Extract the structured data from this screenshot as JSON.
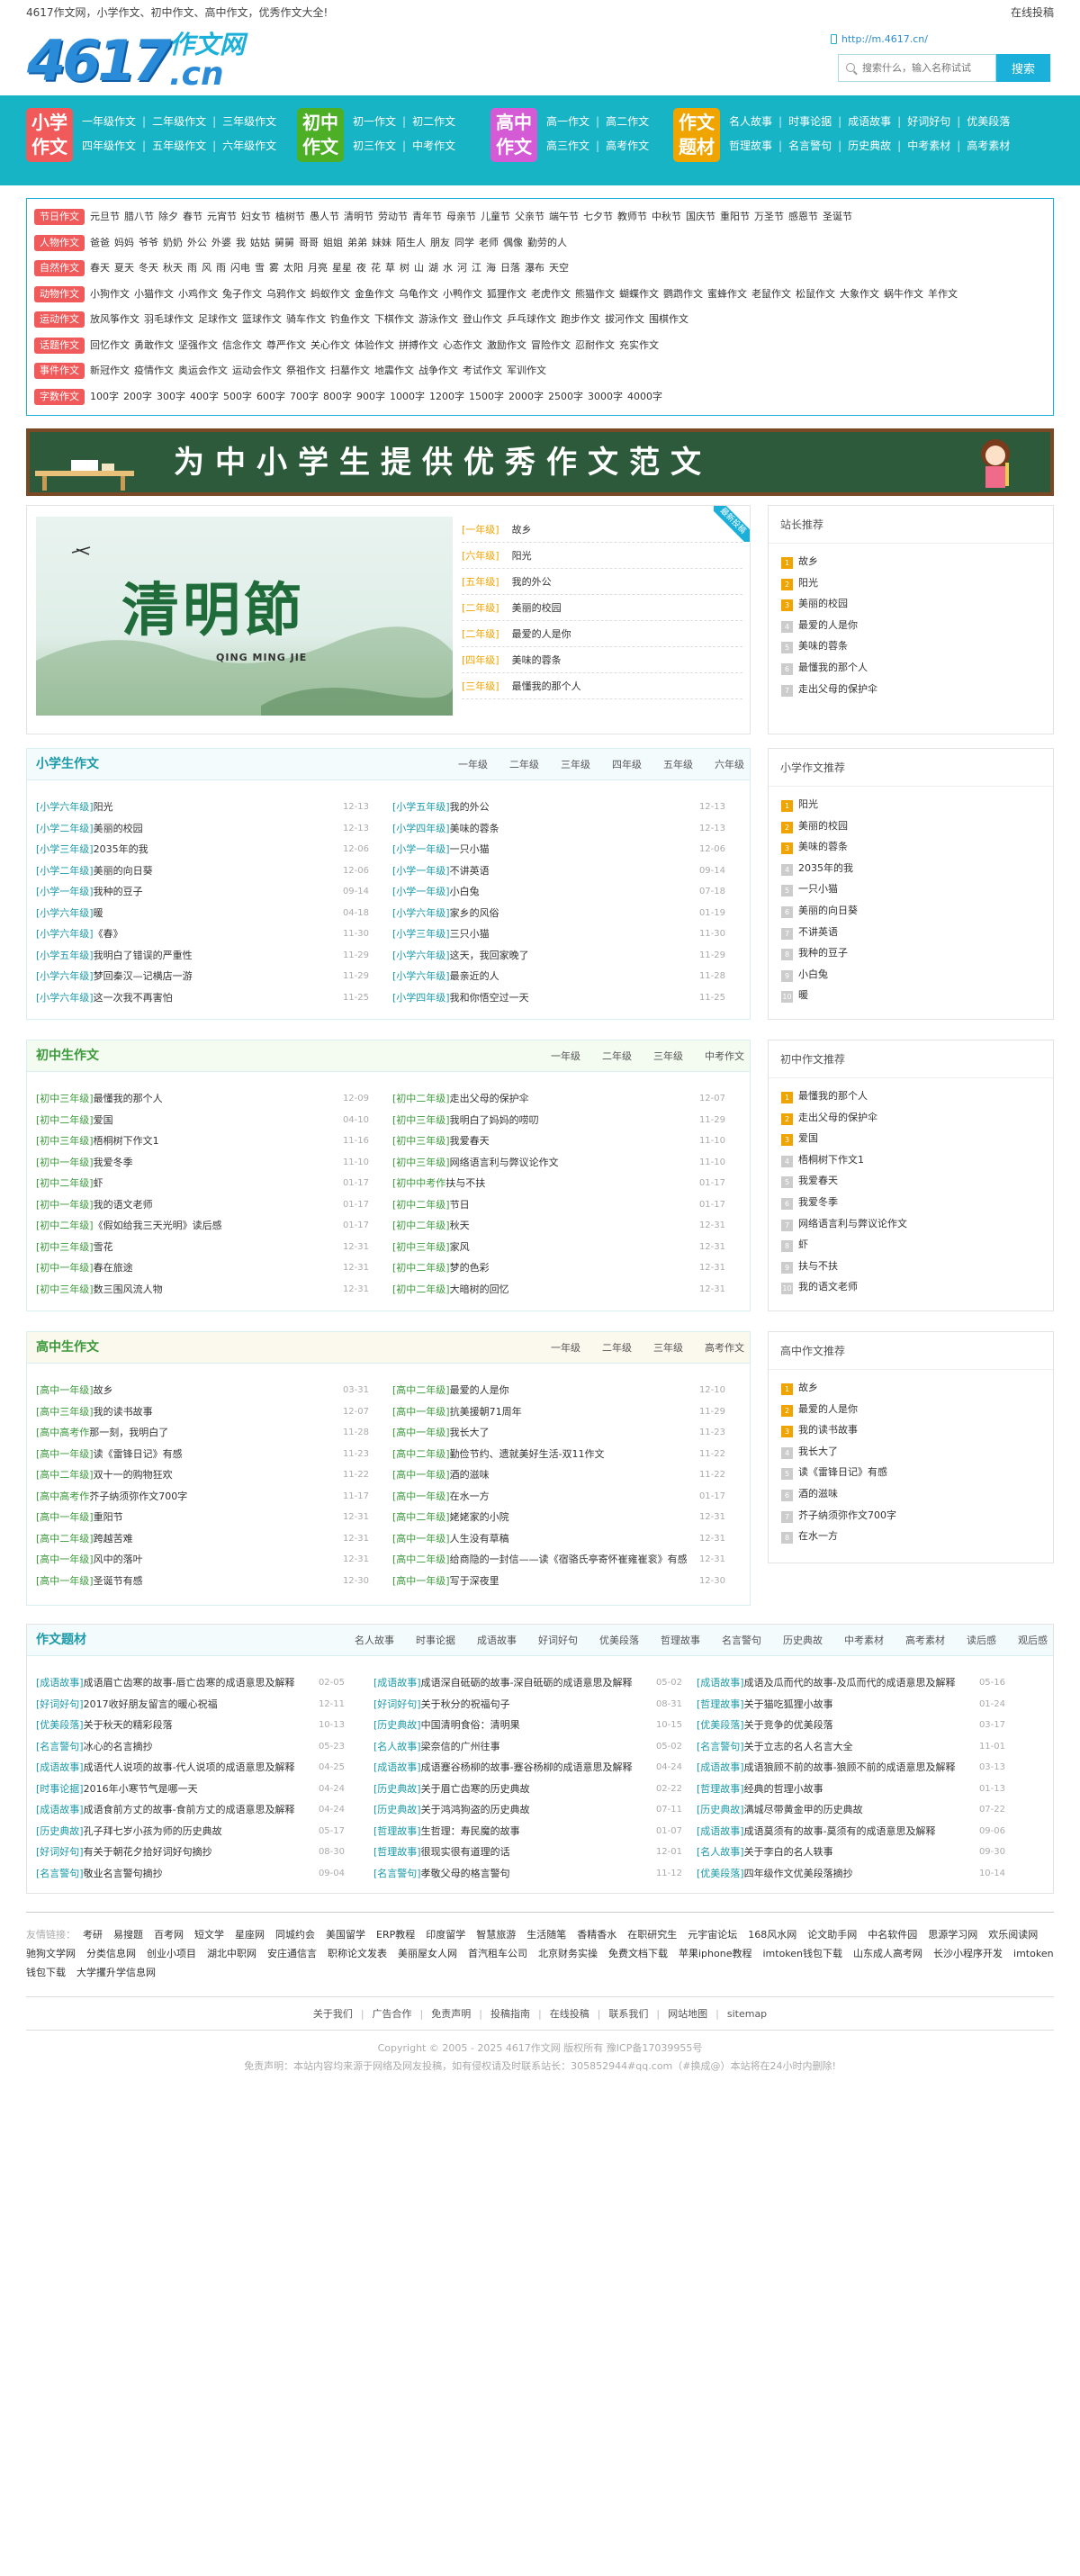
{
  "topbar": {
    "slogan": "4617作文网，小学作文、初中作文、高中作文，优秀作文大全!",
    "right": "在线投稿"
  },
  "header": {
    "logo_num": "4617",
    "logo_zw": "作文网",
    "logo_cn": ".cn",
    "url": "http://m.4617.cn/",
    "search_placeholder": "搜索什么，输入名称试试",
    "search_button": "搜索"
  },
  "nav": [
    {
      "big": [
        "小学",
        "作文"
      ],
      "color": "#f05a5a",
      "rows": [
        [
          "一年级作文",
          "二年级作文",
          "三年级作文"
        ],
        [
          "四年级作文",
          "五年级作文",
          "六年级作文"
        ]
      ]
    },
    {
      "big": [
        "初中",
        "作文"
      ],
      "color": "#4caf26",
      "rows": [
        [
          "初一作文",
          "初二作文"
        ],
        [
          "初三作文",
          "中考作文"
        ]
      ]
    },
    {
      "big": [
        "高中",
        "作文"
      ],
      "color": "#d45bd5",
      "rows": [
        [
          "高一作文",
          "高二作文"
        ],
        [
          "高三作文",
          "高考作文"
        ]
      ]
    },
    {
      "big": [
        "作文",
        "题材"
      ],
      "color": "#f0a400",
      "rows": [
        [
          "名人故事",
          "时事论据",
          "成语故事",
          "好词好句",
          "优美段落"
        ],
        [
          "哲理故事",
          "名言警句",
          "历史典故",
          "中考素材",
          "高考素材"
        ]
      ]
    }
  ],
  "tags": [
    {
      "label": "节日作文",
      "items": [
        "元旦节",
        "腊八节",
        "除夕",
        "春节",
        "元宵节",
        "妇女节",
        "植树节",
        "愚人节",
        "清明节",
        "劳动节",
        "青年节",
        "母亲节",
        "儿童节",
        "父亲节",
        "端午节",
        "七夕节",
        "教师节",
        "中秋节",
        "国庆节",
        "重阳节",
        "万圣节",
        "感恩节",
        "圣诞节"
      ]
    },
    {
      "label": "人物作文",
      "items": [
        "爸爸",
        "妈妈",
        "爷爷",
        "奶奶",
        "外公",
        "外婆",
        "我",
        "姑姑",
        "舅舅",
        "哥哥",
        "姐姐",
        "弟弟",
        "妹妹",
        "陌生人",
        "朋友",
        "同学",
        "老师",
        "偶像",
        "勤劳的人"
      ]
    },
    {
      "label": "自然作文",
      "items": [
        "春天",
        "夏天",
        "冬天",
        "秋天",
        "雨",
        "风",
        "雨",
        "闪电",
        "雪",
        "雾",
        "太阳",
        "月亮",
        "星星",
        "夜",
        "花",
        "草",
        "树",
        "山",
        "湖",
        "水",
        "河",
        "江",
        "海",
        "日落",
        "瀑布",
        "天空"
      ]
    },
    {
      "label": "动物作文",
      "items": [
        "小狗作文",
        "小猫作文",
        "小鸡作文",
        "兔子作文",
        "乌鸦作文",
        "蚂蚁作文",
        "金鱼作文",
        "乌龟作文",
        "小鸭作文",
        "狐狸作文",
        "老虎作文",
        "熊猫作文",
        "蝴蝶作文",
        "鹦鹉作文",
        "蜜蜂作文",
        "老鼠作文",
        "松鼠作文",
        "大象作文",
        "蜗牛作文",
        "羊作文"
      ]
    },
    {
      "label": "运动作文",
      "items": [
        "放风筝作文",
        "羽毛球作文",
        "足球作文",
        "篮球作文",
        "骑车作文",
        "钓鱼作文",
        "下棋作文",
        "游泳作文",
        "登山作文",
        "乒乓球作文",
        "跑步作文",
        "拔河作文",
        "围棋作文"
      ]
    },
    {
      "label": "话题作文",
      "items": [
        "回忆作文",
        "勇敢作文",
        "坚强作文",
        "信念作文",
        "尊严作文",
        "关心作文",
        "体验作文",
        "拼搏作文",
        "心态作文",
        "激励作文",
        "冒险作文",
        "忍耐作文",
        "充实作文"
      ]
    },
    {
      "label": "事件作文",
      "items": [
        "新冠作文",
        "疫情作文",
        "奥运会作文",
        "运动会作文",
        "祭祖作文",
        "扫墓作文",
        "地震作文",
        "战争作文",
        "考试作文",
        "军训作文"
      ]
    },
    {
      "label": "字数作文",
      "items": [
        "100字",
        "200字",
        "300字",
        "400字",
        "500字",
        "600字",
        "700字",
        "800字",
        "900字",
        "1000字",
        "1200字",
        "1500字",
        "2000字",
        "2500字",
        "3000字",
        "4000字"
      ]
    }
  ],
  "banner": {
    "text": "为中小学生提供优秀作文范文"
  },
  "slide": {
    "cal": "清明節",
    "en": "QING MING JIE",
    "ribbon": "最新投稿",
    "list": [
      {
        "g": "[一年级]",
        "t": "故乡"
      },
      {
        "g": "[六年级]",
        "t": "阳光"
      },
      {
        "g": "[五年级]",
        "t": "我的外公"
      },
      {
        "g": "[二年级]",
        "t": "美丽的校园"
      },
      {
        "g": "[二年级]",
        "t": "最爱的人是你"
      },
      {
        "g": "[四年级]",
        "t": "美味的蓉条"
      },
      {
        "g": "[三年级]",
        "t": "最懂我的那个人"
      }
    ]
  },
  "side1": {
    "title": "站长推荐",
    "items": [
      "故乡",
      "阳光",
      "美丽的校园",
      "最爱的人是你",
      "美味的蓉条",
      "最懂我的那个人",
      "走出父母的保护伞"
    ]
  },
  "p1": {
    "title": "小学生作文",
    "tabs": [
      "一年级",
      "二年级",
      "三年级",
      "四年级",
      "五年级",
      "六年级"
    ],
    "left": [
      [
        "[小学六年级]",
        "阳光",
        "12-13"
      ],
      [
        "[小学二年级]",
        "美丽的校园",
        "12-13"
      ],
      [
        "[小学三年级]",
        "2035年的我",
        "12-06"
      ],
      [
        "[小学二年级]",
        "美丽的向日葵",
        "12-06"
      ],
      [
        "[小学一年级]",
        "我种的豆子",
        "09-14"
      ],
      [
        "[小学六年级]",
        "暖",
        "04-18"
      ],
      [
        "[小学六年级]",
        "《春》",
        "11-30"
      ],
      [
        "[小学五年级]",
        "我明白了错误的严重性",
        "11-29"
      ],
      [
        "[小学六年级]",
        "梦回秦汉—记横店一游",
        "11-29"
      ],
      [
        "[小学六年级]",
        "这一次我不再害怕",
        "11-25"
      ]
    ],
    "right": [
      [
        "[小学五年级]",
        "我的外公",
        "12-13"
      ],
      [
        "[小学四年级]",
        "美味的蓉条",
        "12-13"
      ],
      [
        "[小学一年级]",
        "一只小猫",
        "12-06"
      ],
      [
        "[小学一年级]",
        "不讲英语",
        "09-14"
      ],
      [
        "[小学一年级]",
        "小白兔",
        "07-18"
      ],
      [
        "[小学六年级]",
        "家乡的风俗",
        "01-19"
      ],
      [
        "[小学三年级]",
        "三只小猫",
        "11-30"
      ],
      [
        "[小学六年级]",
        "这天，我回家晚了",
        "11-29"
      ],
      [
        "[小学六年级]",
        "最亲近的人",
        "11-28"
      ],
      [
        "[小学四年级]",
        "我和你悟空过一天",
        "11-25"
      ]
    ]
  },
  "side2": {
    "title": "小学作文推荐",
    "items": [
      "阳光",
      "美丽的校园",
      "美味的蓉条",
      "2035年的我",
      "一只小猫",
      "美丽的向日葵",
      "不讲英语",
      "我种的豆子",
      "小白兔",
      "暖"
    ]
  },
  "p2": {
    "title": "初中生作文",
    "tabs": [
      "一年级",
      "二年级",
      "三年级",
      "中考作文"
    ],
    "left": [
      [
        "[初中三年级]",
        "最懂我的那个人",
        "12-09"
      ],
      [
        "[初中二年级]",
        "爱国",
        "04-10"
      ],
      [
        "[初中三年级]",
        "梧桐树下作文1",
        "11-16"
      ],
      [
        "[初中一年级]",
        "我爱冬季",
        "11-10"
      ],
      [
        "[初中二年级]",
        "虾",
        "01-17"
      ],
      [
        "[初中一年级]",
        "我的语文老师",
        "01-17"
      ],
      [
        "[初中二年级]",
        "《假如给我三天光明》读后感",
        "01-17"
      ],
      [
        "[初中三年级]",
        "雪花",
        "12-31"
      ],
      [
        "[初中一年级]",
        "春在旅途",
        "12-31"
      ],
      [
        "[初中三年级]",
        "数三围风流人物",
        "12-31"
      ]
    ],
    "right": [
      [
        "[初中二年级]",
        "走出父母的保护伞",
        "12-07"
      ],
      [
        "[初中三年级]",
        "我明白了妈妈的唠叨",
        "11-29"
      ],
      [
        "[初中三年级]",
        "我爱春天",
        "11-10"
      ],
      [
        "[初中三年级]",
        "网络语言利与弊议论作文",
        "11-10"
      ],
      [
        "[初中中考作",
        "扶与不扶",
        "01-17"
      ],
      [
        "[初中二年级]",
        "节日",
        "01-17"
      ],
      [
        "[初中二年级]",
        "秋天",
        "12-31"
      ],
      [
        "[初中三年级]",
        "家风",
        "12-31"
      ],
      [
        "[初中二年级]",
        "梦的色彩",
        "12-31"
      ],
      [
        "[初中二年级]",
        "大暗树的回忆",
        "12-31"
      ]
    ]
  },
  "side3": {
    "title": "初中作文推荐",
    "items": [
      "最懂我的那个人",
      "走出父母的保护伞",
      "爱国",
      "梧桐树下作文1",
      "我爱春天",
      "我爱冬季",
      "网络语言利与弊议论作文",
      "虾",
      "扶与不扶",
      "我的语文老师"
    ]
  },
  "p3": {
    "title": "高中生作文",
    "tabs": [
      "一年级",
      "二年级",
      "三年级",
      "高考作文"
    ],
    "left": [
      [
        "[高中一年级]",
        "故乡",
        "03-31"
      ],
      [
        "[高中三年级]",
        "我的读书故事",
        "12-07"
      ],
      [
        "[高中高考作",
        "那一刻，我明白了",
        "11-28"
      ],
      [
        "[高中一年级]",
        "读《雷锋日记》有感",
        "11-23"
      ],
      [
        "[高中二年级]",
        "双十一的购物狂欢",
        "11-22"
      ],
      [
        "[高中高考作",
        "芥子纳须弥作文700字",
        "11-17"
      ],
      [
        "[高中一年级]",
        "重阳节",
        "12-31"
      ],
      [
        "[高中二年级]",
        "跨越苦难",
        "12-31"
      ],
      [
        "[高中一年级]",
        "风中的落叶",
        "12-31"
      ],
      [
        "[高中一年级]",
        "圣诞节有感",
        "12-30"
      ]
    ],
    "right": [
      [
        "[高中二年级]",
        "最爱的人是你",
        "12-10"
      ],
      [
        "[高中一年级]",
        "抗美援朝71周年",
        "11-29"
      ],
      [
        "[高中一年级]",
        "我长大了",
        "11-23"
      ],
      [
        "[高中二年级]",
        "勤俭节约、遗就美好生活-双11作文",
        "11-22"
      ],
      [
        "[高中一年级]",
        "酒的滋味",
        "11-22"
      ],
      [
        "[高中一年级]",
        "在水一方",
        "01-17"
      ],
      [
        "[高中二年级]",
        "姥姥家的小院",
        "12-31"
      ],
      [
        "[高中一年级]",
        "人生没有草稿",
        "12-31"
      ],
      [
        "[高中二年级]",
        "给商隐的一封信——读《宿骆氏亭寄怀崔雍崔衮》有感",
        "12-31"
      ],
      [
        "[高中一年级]",
        "写于深夜里",
        "12-30"
      ]
    ]
  },
  "side4": {
    "title": "高中作文推荐",
    "items": [
      "故乡",
      "最爱的人是你",
      "我的读书故事",
      "我长大了",
      "读《雷锋日记》有感",
      "酒的滋味",
      "芥子纳须弥作文700字",
      "在水一方"
    ]
  },
  "p4": {
    "title": "作文题材",
    "tabs": [
      "名人故事",
      "时事论据",
      "成语故事",
      "好词好句",
      "优美段落",
      "哲理故事",
      "名言警句",
      "历史典故",
      "中考素材",
      "高考素材",
      "读后感",
      "观后感"
    ],
    "c1": [
      [
        "[成语故事]",
        "成语眉亡齿寒的故事-唇亡齿寒的成语意思及解释",
        "02-05"
      ],
      [
        "[好词好句]",
        "2017收好朋友留言的暖心祝福",
        "12-11"
      ],
      [
        "[优美段落]",
        "关于秋天的精彩段落",
        "10-13"
      ],
      [
        "[名言警句]",
        "冰心的名言摘抄",
        "05-23"
      ],
      [
        "[成语故事]",
        "成语代人说项的故事-代人说项的成语意思及解释",
        "04-25"
      ],
      [
        "[时事论据]",
        "2016年小寒节气是哪一天",
        "04-24"
      ],
      [
        "[成语故事]",
        "成语食前方丈的故事-食前方丈的成语意思及解释",
        "04-24"
      ],
      [
        "[历史典故]",
        "孔子拜七岁小孩为师的历史典故",
        "05-17"
      ],
      [
        "[好词好句]",
        "有关于朝花夕拾好词好句摘抄",
        "08-30"
      ],
      [
        "[名言警句]",
        "敬业名言警句摘抄",
        "09-04"
      ]
    ],
    "c2": [
      [
        "[成语故事]",
        "成语深自砥砺的故事-深自砥砺的成语意思及解释",
        "05-02"
      ],
      [
        "[好词好句]",
        "关于秋分的祝福句子",
        "08-31"
      ],
      [
        "[历史典故]",
        "中国清明食俗：清明果",
        "10-15"
      ],
      [
        "[名人故事]",
        "梁奈信的广州往事",
        "05-02"
      ],
      [
        "[成语故事]",
        "成语蹇谷杨柳的故事-蹇谷杨柳的成语意思及解释",
        "04-24"
      ],
      [
        "[历史典故]",
        "关于眉亡齿寒的历史典故",
        "02-22"
      ],
      [
        "[历史典故]",
        "关于鸿鸿狗盗的历史典故",
        "07-11"
      ],
      [
        "[哲理故事]",
        "生哲理：寿民魔的故事",
        "01-07"
      ],
      [
        "[哲理故事]",
        "很现实很有道理的话",
        "12-01"
      ],
      [
        "[名言警句]",
        "孝敬父母的格言警句",
        "11-12"
      ]
    ],
    "c3": [
      [
        "[成语故事]",
        "成语及瓜而代的故事-及瓜而代的成语意思及解释",
        "05-16"
      ],
      [
        "[哲理故事]",
        "关于猫吃狐狸小故事",
        "01-24"
      ],
      [
        "[优美段落]",
        "关于竞争的优美段落",
        "03-17"
      ],
      [
        "[名言警句]",
        "关于立志的名人名言大全",
        "11-01"
      ],
      [
        "[成语故事]",
        "成语狼顾不前的故事-狼顾不前的成语意思及解释",
        "03-13"
      ],
      [
        "[哲理故事]",
        "经典的哲理小故事",
        "01-13"
      ],
      [
        "[历史典故]",
        "满城尽带黄金甲的历史典故",
        "07-22"
      ],
      [
        "[成语故事]",
        "成语莫须有的故事-莫须有的成语意思及解释",
        "09-06"
      ],
      [
        "[名人故事]",
        "关于李白的名人轶事",
        "09-30"
      ],
      [
        "[优美段落]",
        "四年级作文优美段落摘抄",
        "10-14"
      ]
    ]
  },
  "friends": {
    "label": "友情链接：",
    "items": [
      "考研",
      "易搜题",
      "百考网",
      "短文学",
      "星座网",
      "同城约会",
      "美国留学",
      "ERP教程",
      "印度留学",
      "智慧旅游",
      "生活随笔",
      "香精香水",
      "在职研究生",
      "元宇宙论坛",
      "168风水网",
      "论文助手网",
      "中名软件园",
      "思源学习网",
      "欢乐阅读网",
      "驰狗文学网",
      "分类信息网",
      "创业小项目",
      "湖北中职网",
      "安庄通信言",
      "职称论文发表",
      "美丽屋女人网",
      "首汽租车公司",
      "北京财务实操",
      "免费文档下载",
      "苹果iphone教程",
      "imtoken钱包下载",
      "山东成人高考网",
      "长沙小程序开发",
      "imtoken钱包下载",
      "大学攫升学信息网"
    ]
  },
  "fnav": [
    "关于我们",
    "广告合作",
    "免责声明",
    "投稿指南",
    "在线投稿",
    "联系我们",
    "网站地图",
    "sitemap"
  ],
  "copy": "Copyright © 2005 - 2025 4617作文网 版权所有  豫ICP备17039955号",
  "disclaimer": "免责声明：本站内容均来源于网络及网友投稿，如有侵权请及时联系站长：305852944#qq.com（#换成@）本站将在24小时内删除!"
}
